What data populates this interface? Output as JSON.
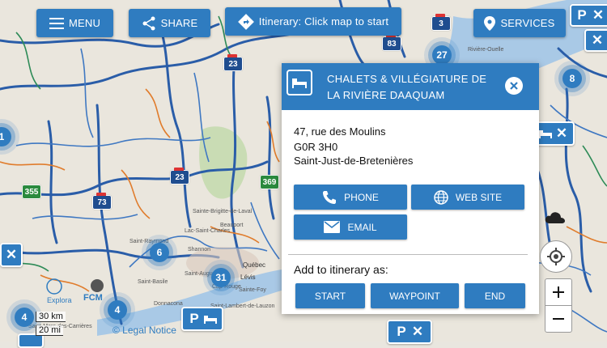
{
  "toolbar": {
    "menu_label": "MENU",
    "share_label": "SHARE",
    "itinerary_label": "Itinerary: Click map to start",
    "services_label": "SERVICES"
  },
  "popup": {
    "title": "CHALETS & VILLÉGIATURE DE LA RIVIÈRE DAAQUAM",
    "address_line1": "47, rue des Moulins",
    "address_line2": "G0R 3H0",
    "address_line3": "Saint-Just-de-Bretenières",
    "phone_label": "PHONE",
    "website_label": "WEB SITE",
    "email_label": "EMAIL",
    "add_to_itinerary_label": "Add to itinerary as:",
    "start_label": "START",
    "waypoint_label": "WAYPOINT",
    "end_label": "END"
  },
  "map": {
    "clusters": [
      "27",
      "8",
      "1",
      "6",
      "31",
      "4",
      "4"
    ],
    "highways": [
      "23",
      "83",
      "3",
      "23",
      "355",
      "73",
      "369"
    ],
    "place_labels": [
      "Rivière-Ouelle",
      "Sainte-Brigitte-de-Laval",
      "Lac-Saint-Charles",
      "Beauport",
      "Shannon",
      "Québec",
      "Lévis",
      "Cap-Rouge",
      "Saint-Augustin",
      "Sainte-Foy",
      "Saint-Lambert-de-Lauzon",
      "Donnacona",
      "Saint-Raymond",
      "Saint-Basile",
      "Saint-Marc-des-Carrières"
    ],
    "legal_notice": "© Legal Notice",
    "scale_km": "30 km",
    "scale_mi": "20 mi",
    "poi_parking": "P",
    "logo_text": "Explora",
    "logo_text2": "FCM"
  },
  "colors": {
    "accent": "#2f7cc0",
    "road_blue": "#2a5da8",
    "road_orange": "#e07c2c",
    "road_green": "#2e8b57"
  }
}
